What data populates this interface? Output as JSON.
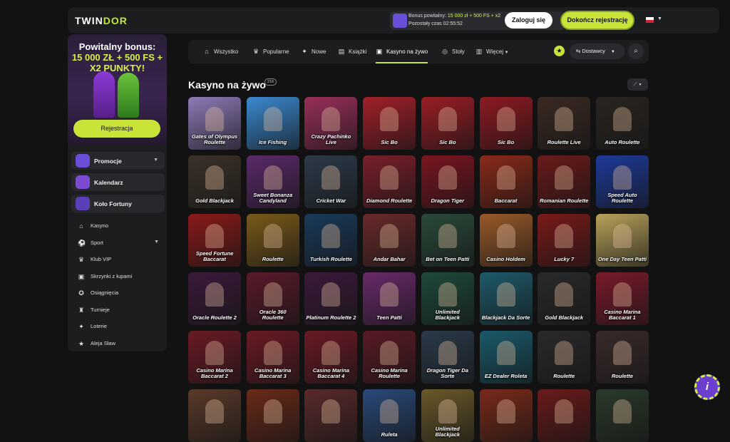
{
  "header": {
    "logo_prefix": "TWIN",
    "logo_suffix": "DOR",
    "bonus_line1_prefix": "Bonus powitalny:",
    "bonus_line1_value": "15 000 zł + 500 FS + x2",
    "bonus_line2": "Pozostały czas 02:55:52",
    "login_label": "Zaloguj się",
    "register_label": "Dokończ rejestrację",
    "language_flag": "pl-flag-icon"
  },
  "sidebar": {
    "promo_line1": "Powitalny bonus:",
    "promo_line2": "15 000 ZŁ + 500 FS +",
    "promo_line3": "X2 PUNKTY!",
    "promo_button": "Rejestracja",
    "cards": [
      {
        "label": "Promocje",
        "color": "#6b4fd8"
      },
      {
        "label": "Kalendarz",
        "color": "#7a4ad0"
      },
      {
        "label": "Koło Fortuny",
        "color": "#5a3fb8"
      }
    ],
    "nav": [
      {
        "label": "Kasyno",
        "icon": "⌂"
      },
      {
        "label": "Sport",
        "icon": "⚽"
      },
      {
        "label": "Klub VIP",
        "icon": "♛"
      },
      {
        "label": "Skrzynki z łupami",
        "icon": "▣"
      },
      {
        "label": "Osiągnięcia",
        "icon": "✪"
      },
      {
        "label": "Turnieje",
        "icon": "♜"
      },
      {
        "label": "Loterie",
        "icon": "✦"
      },
      {
        "label": "Aleja Sław",
        "icon": "★"
      }
    ]
  },
  "tabs": [
    {
      "label": "Wszystko",
      "icon": "⌂"
    },
    {
      "label": "Popularne",
      "icon": "♛"
    },
    {
      "label": "Nowe",
      "icon": "✦"
    },
    {
      "label": "Książki",
      "icon": "▤"
    },
    {
      "label": "Kasyno na żywo",
      "icon": "▣",
      "active": true
    },
    {
      "label": "Stoły",
      "icon": "◎"
    },
    {
      "label": "Więcej",
      "icon": "▥"
    }
  ],
  "toolbar": {
    "providers_label": "Dostawcy",
    "star": "★"
  },
  "section": {
    "title": "Kasyno na żywo",
    "count": "216"
  },
  "games": [
    {
      "name": "Gates of Olympus Roulette",
      "bg": "#8f7ab8"
    },
    {
      "name": "Ice Fishing",
      "bg": "#3a8ad0"
    },
    {
      "name": "Crazy Pachinko Live",
      "bg": "#9a2f5a"
    },
    {
      "name": "Sic Bo",
      "bg": "#a3202a"
    },
    {
      "name": "Sic Bo",
      "bg": "#9a1e26"
    },
    {
      "name": "Sic Bo",
      "bg": "#8e1a22"
    },
    {
      "name": "Roulette Live",
      "bg": "#3a2a22"
    },
    {
      "name": "Auto Roulette",
      "bg": "#2a2520"
    },
    {
      "name": "Gold Blackjack",
      "bg": "#3b3228"
    },
    {
      "name": "Sweet Bonanza Candyland",
      "bg": "#5a2a6a"
    },
    {
      "name": "Cricket War",
      "bg": "#2c3a4a"
    },
    {
      "name": "Diamond Roulette",
      "bg": "#7a1f2a"
    },
    {
      "name": "Dragon Tiger",
      "bg": "#7a1520"
    },
    {
      "name": "Baccarat",
      "bg": "#8a2a1a"
    },
    {
      "name": "Romanian Roulette",
      "bg": "#6a1a1a"
    },
    {
      "name": "Speed Auto Roulette",
      "bg": "#1e3a9a"
    },
    {
      "name": "Speed Fortune Baccarat",
      "bg": "#8a1a1a"
    },
    {
      "name": "Roulette",
      "bg": "#7a5a1a"
    },
    {
      "name": "Turkish Roulette",
      "bg": "#1a3a5a"
    },
    {
      "name": "Andar Bahar",
      "bg": "#6a2a2a"
    },
    {
      "name": "Bet on Teen Patti",
      "bg": "#2a4a3a"
    },
    {
      "name": "Casino Holdem",
      "bg": "#9a5a2a"
    },
    {
      "name": "Lucky 7",
      "bg": "#7a1a1a"
    },
    {
      "name": "One Day Teen Patti",
      "bg": "#b8a25a"
    },
    {
      "name": "Oracle Roulette 2",
      "bg": "#3a1a3a"
    },
    {
      "name": "Oracle 360 Roulette",
      "bg": "#5a1a2a"
    },
    {
      "name": "Platinum Roulette 2",
      "bg": "#3a1a3a"
    },
    {
      "name": "Teen Patti",
      "bg": "#6a2a6a"
    },
    {
      "name": "Unlimited Blackjack",
      "bg": "#1e4a3a"
    },
    {
      "name": "Blackjack Da Sorte",
      "bg": "#1e5a6a"
    },
    {
      "name": "Gold Blackjack",
      "bg": "#2a2a2a"
    },
    {
      "name": "Casino Marina Baccarat 1",
      "bg": "#7a1a2a"
    },
    {
      "name": "Casino Marina Baccarat 2",
      "bg": "#6a1a24"
    },
    {
      "name": "Casino Marina Baccarat 3",
      "bg": "#6a1a24"
    },
    {
      "name": "Casino Marina Baccarat 4",
      "bg": "#6a1a24"
    },
    {
      "name": "Casino Marina Roulette",
      "bg": "#5a1a24"
    },
    {
      "name": "Dragon Tiger Da Sorte",
      "bg": "#2a3a4a"
    },
    {
      "name": "EZ Dealer Roleta",
      "bg": "#1a5a6a"
    },
    {
      "name": "Roulette",
      "bg": "#2a2a2a"
    },
    {
      "name": "Roulette",
      "bg": "#3a2a2a"
    },
    {
      "name": "",
      "bg": "#5a3a2a"
    },
    {
      "name": "",
      "bg": "#6a2a1a"
    },
    {
      "name": "",
      "bg": "#5a2a2a"
    },
    {
      "name": "Ruleta",
      "bg": "#2a4a7a"
    },
    {
      "name": "Unlimited Blackjack",
      "bg": "#6a5a2a"
    },
    {
      "name": "",
      "bg": "#7a2a1a"
    },
    {
      "name": "",
      "bg": "#6a1a1a"
    },
    {
      "name": "",
      "bg": "#2a3a2a"
    }
  ],
  "fab_label": "i"
}
